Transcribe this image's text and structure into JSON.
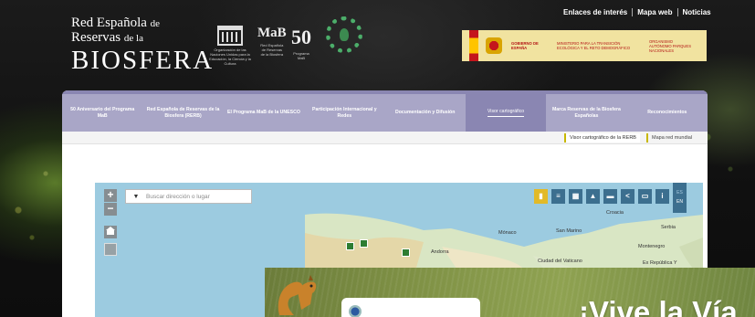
{
  "top_links": [
    "Enlaces de interés",
    "Mapa web",
    "Noticias"
  ],
  "logo": {
    "line1": "Red Española",
    "line1_suffix": "de",
    "line2": "Reservas",
    "line2_suffix": "de la",
    "line3": "BIOSFERA"
  },
  "institutions": {
    "unesco_caption": "Organización de las Naciones Unidas para la Educación, la Ciencia y la Cultura",
    "mab_glyph": "MaB",
    "mab_caption": "Red Española de Reservas de la Biosfera",
    "fifty_glyph": "50",
    "fifty_caption": "Programa MaB"
  },
  "government": {
    "left": "GOBIERNO DE ESPAÑA",
    "middle": "MINISTERIO PARA LA TRANSICIÓN ECOLÓGICA Y EL RETO DEMOGRÁFICO",
    "right": "ORGANISMO AUTÓNOMO PARQUES NACIONALES"
  },
  "nav": [
    {
      "label": "50 Aniversario del Programa MaB",
      "active": false
    },
    {
      "label": "Red Española de Reservas de la Biosfera (RERB)",
      "active": false
    },
    {
      "label": "El Programa MaB de la UNESCO",
      "active": false
    },
    {
      "label": "Participación Internacional y Redes",
      "active": false
    },
    {
      "label": "Documentación y Difusión",
      "active": false
    },
    {
      "label": "Visor cartográfico",
      "active": true
    },
    {
      "label": "Marca Reservas de la Biosfera Españolas",
      "active": false
    },
    {
      "label": "Reconocimientos",
      "active": false
    }
  ],
  "subnav": [
    "Visor cartográfico de la RERB",
    "Mapa red mundial"
  ],
  "map": {
    "search_placeholder": "Buscar dirección o lugar",
    "zoom_in": "+",
    "zoom_out": "−",
    "lang_es": "ES",
    "lang_en": "EN",
    "labels": {
      "andorra": "Andorra",
      "monaco": "Mónaco",
      "san_marino": "San Marino",
      "serbia": "Serbia",
      "montenegro": "Montenegro",
      "vaticano": "Ciudad del Vaticano",
      "croacia": "Croacia",
      "rep": "Ex República Y"
    },
    "colors": {
      "sea": "#9ccbe0",
      "land": "#d9e6c4",
      "toolbar": "#3c6f8f",
      "accent": "#e2ba28"
    }
  },
  "overlay": {
    "headline": "¡Vive la Vía"
  },
  "colors": {
    "nav_bg": "#a9a6c7",
    "nav_active": "#8a86b2",
    "gov_bg": "#f1e3a0"
  }
}
